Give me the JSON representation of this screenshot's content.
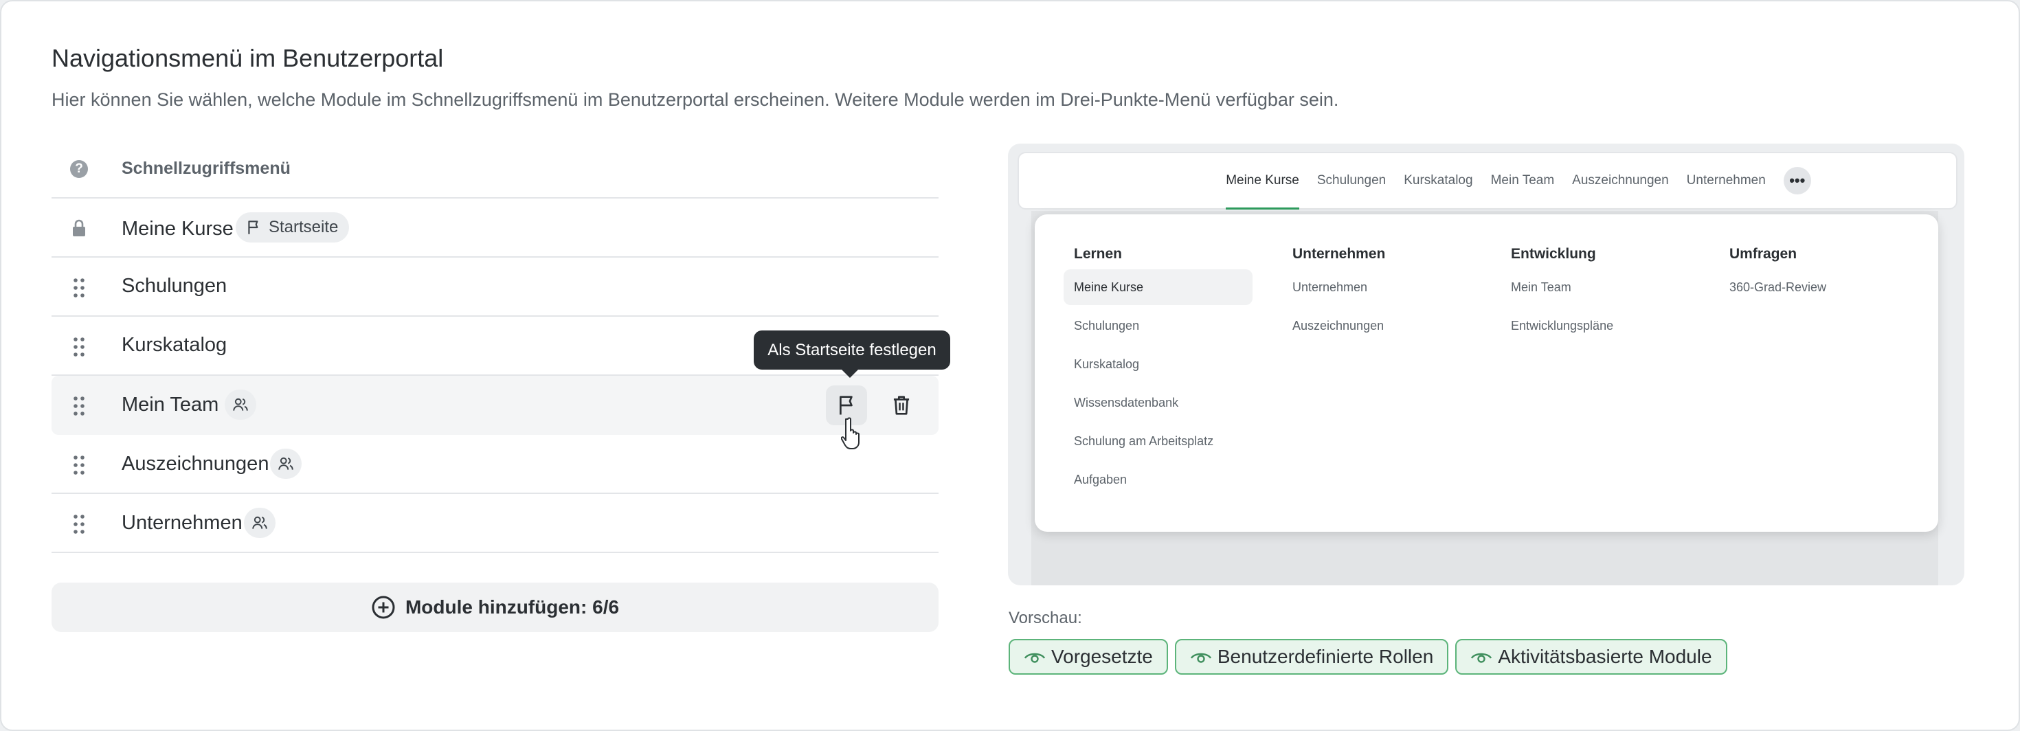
{
  "header": {
    "title": "Navigationsmenü im Benutzerportal",
    "description": "Hier können Sie wählen, welche Module im Schnellzugriffsmenü im Benutzerportal erscheinen. Weitere Module werden im Drei-Punkte-Menü verfügbar sein."
  },
  "quick_menu": {
    "header_label": "Schnellzugriffsmenü",
    "help_icon": "question-circle-icon",
    "rows": [
      {
        "label": "Meine Kurse",
        "icon": "lock-icon",
        "badge": "Startseite",
        "badge_icon": "flag-icon"
      },
      {
        "label": "Schulungen",
        "icon": "drag-handle-icon"
      },
      {
        "label": "Kurskatalog",
        "icon": "drag-handle-icon"
      },
      {
        "label": "Mein Team",
        "icon": "drag-handle-icon",
        "badge_icon": "users-icon"
      },
      {
        "label": "Auszeichnungen",
        "icon": "drag-handle-icon",
        "badge_icon": "users-icon"
      },
      {
        "label": "Unternehmen",
        "icon": "drag-handle-icon",
        "badge_icon": "users-icon"
      }
    ],
    "tooltip": "Als Startseite festlegen",
    "add_button_label": "Module hinzufügen: 6/6"
  },
  "preview": {
    "tabs": [
      "Meine Kurse",
      "Schulungen",
      "Kurskatalog",
      "Mein Team",
      "Auszeichnungen",
      "Unternehmen"
    ],
    "more_label": "•••",
    "columns": [
      {
        "title": "Lernen",
        "items": [
          "Meine Kurse",
          "Schulungen",
          "Kurskatalog",
          "Wissensdatenbank",
          "Schulung am Arbeitsplatz",
          "Aufgaben"
        ]
      },
      {
        "title": "Unternehmen",
        "items": [
          "Unternehmen",
          "Auszeichnungen"
        ]
      },
      {
        "title": "Entwicklung",
        "items": [
          "Mein Team",
          "Entwicklungspläne"
        ]
      },
      {
        "title": "Umfragen",
        "items": [
          "360-Grad-Review"
        ]
      }
    ],
    "label": "Vorschau:",
    "chips": [
      "Vorgesetzte",
      "Benutzerdefinierte Rollen",
      "Aktivitätsbasierte Module"
    ]
  },
  "colors": {
    "accent_green": "#2e9c5d",
    "chip_background": "#e8f5ec",
    "chip_border": "#5cb47a",
    "tooltip_background": "#2b2f33"
  }
}
